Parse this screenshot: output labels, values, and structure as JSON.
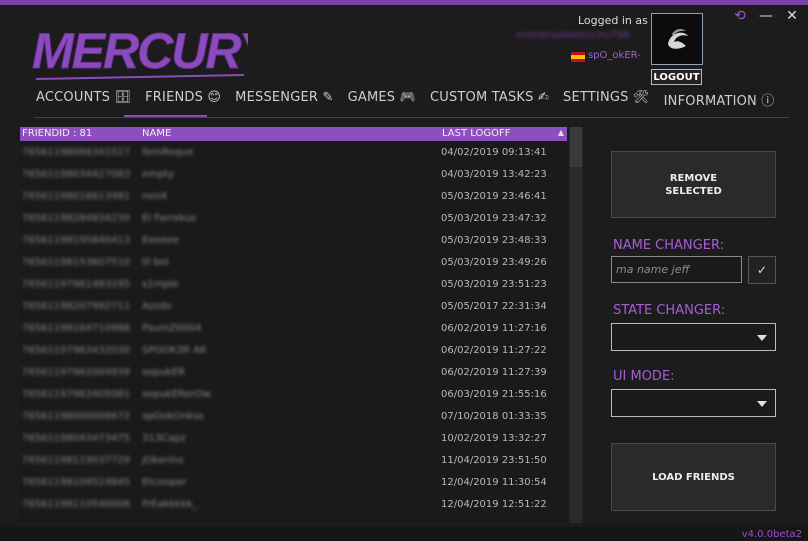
{
  "app": {
    "logo_text": "MERCURY",
    "version": "v4.0.0beta2",
    "accent": "#8d4fbf"
  },
  "login": {
    "label": "Logged in as",
    "account": "monstrodadotucho798",
    "persona": "spO_okER-",
    "logout": "LOGOUT"
  },
  "nav": {
    "items": [
      {
        "label": "ACCOUNTS 🗄",
        "icon": "building-icon"
      },
      {
        "label": "FRIENDS 😊",
        "icon": "smiley-icon"
      },
      {
        "label": "MESSENGER ✎",
        "icon": "pencil-icon"
      },
      {
        "label": "GAMES 🎮",
        "icon": "gamepad-icon"
      },
      {
        "label": "CUSTOM TASKS ✍",
        "icon": "tasks-icon"
      },
      {
        "label": "SETTINGS 🛠",
        "icon": "wrench-icon"
      },
      {
        "label": "INFORMATION ⓘ",
        "icon": "info-icon"
      }
    ],
    "active": "FRIENDS"
  },
  "list": {
    "headers": {
      "id": "FRIENDID : 81",
      "name": "NAME",
      "last": "LAST LOGOFF"
    },
    "rows": [
      {
        "id": "76561198066341527",
        "name": "fernRoque",
        "last": "04/02/2019 09:13:41"
      },
      {
        "id": "76561198034427083",
        "name": "empty",
        "last": "04/03/2019 13:42:23"
      },
      {
        "id": "76561198016613481",
        "name": "neoX",
        "last": "05/03/2019 23:46:41"
      },
      {
        "id": "76561198284834230",
        "name": "El Farrekus",
        "last": "05/03/2019 23:47:32"
      },
      {
        "id": "76561198195840413",
        "name": "Eeeeee",
        "last": "05/03/2019 23:48:33"
      },
      {
        "id": "76561198153607510",
        "name": "lil boi",
        "last": "05/03/2019 23:49:26"
      },
      {
        "id": "76561197961483295",
        "name": "s1mple",
        "last": "05/03/2019 23:51:23"
      },
      {
        "id": "76561198207992711",
        "name": "Azzdo",
        "last": "05/05/2017 22:31:34"
      },
      {
        "id": "76561198164710986",
        "name": "PsumZ0004",
        "last": "06/02/2019 11:27:16"
      },
      {
        "id": "76561197963432030",
        "name": "SPOOK3R AK",
        "last": "06/02/2019 11:27:22"
      },
      {
        "id": "76561197962004939",
        "name": "sepukER",
        "last": "06/02/2019 11:27:39"
      },
      {
        "id": "76561197963405081",
        "name": "sepukERerOw",
        "last": "06/03/2019 21:55:16"
      },
      {
        "id": "76561198000006672",
        "name": "spOokOnkss",
        "last": "07/10/2018 01:33:35"
      },
      {
        "id": "76561198043473475",
        "name": "313Capz",
        "last": "10/02/2019 13:32:27"
      },
      {
        "id": "76561198119037729",
        "name": "jOkerino",
        "last": "11/04/2019 23:51:50"
      },
      {
        "id": "76561198109524845",
        "name": "Etcooper",
        "last": "12/04/2019 11:30:54"
      },
      {
        "id": "76561198110540006",
        "name": "FrEakkkkk_",
        "last": "12/04/2019 12:51:22"
      }
    ]
  },
  "side": {
    "remove_btn": "REMOVE\nSELECTED",
    "name_changer_label": "NAME CHANGER:",
    "name_placeholder": "ma name jeff",
    "name_value": "",
    "confirm_icon": "✓",
    "state_label": "STATE CHANGER:",
    "state_value": "",
    "ui_label": "UI MODE:",
    "ui_value": "",
    "load_btn": "LOAD FRIENDS"
  }
}
